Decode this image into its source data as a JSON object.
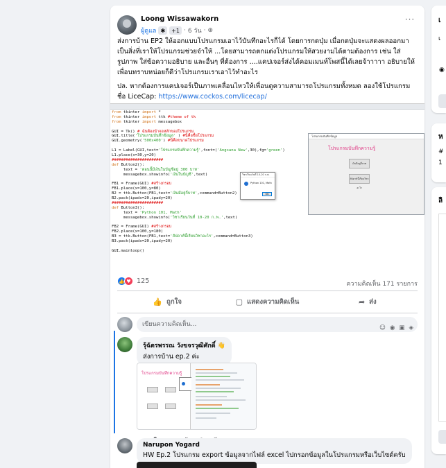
{
  "post": {
    "author": "Loong Wissawakorn",
    "role": "ผู้ดูแล",
    "badge": "+1",
    "time": "6 วัน",
    "privacy_icon": "globe-icon",
    "more_icon": "more-horizontal-icon",
    "paragraph1": "ส่งการบ้าน EP2 ให้ออกแบบโปรแกรมเอาไว้บันทึกอะไรก็ได้ โดยการกดปุ่ม เมื่อกดปุ่มจะแสดงผลออกมาเป็นสิ่งที่เราให้โปรแกรมช่วยจำให้ ...โดยสามารถตกแต่งโปรแกรมให้สวยงามได้ตามต้องการ เช่น ใส่รูปภาพ ใส่ข้อความอธิบาย และอื่นๆ ที่ต้องการ ....แคปเจอร์ส่งได้คอมเมนท์โพสนี้ได้เลยจ้าาาาา อธิบายให้เพื่อนทราบหน่อยก็ดีว่าโปรแกรมเราเอาไว้ทำอะไร",
    "paragraph2": "ปล. หากต้องการแคปเจอร์เป็นภาพเคลื่อนไหวให้เพื่อนดูความสามารถโปรแกรมทั้งหมด ลองใช้โปรแกรมชื่อ LiceCap: ",
    "link": "https://www.cockos.com/licecap/"
  },
  "screenshot": {
    "code_lines": [
      [
        [
          "kw",
          "from "
        ],
        [
          "",
          "tkinter "
        ],
        [
          "kw",
          "import "
        ],
        [
          "",
          "*"
        ]
      ],
      [
        [
          "kw",
          "from "
        ],
        [
          "",
          "tkinter "
        ],
        [
          "kw",
          "import "
        ],
        [
          "",
          "ttk "
        ],
        [
          "cm",
          "#theme of tk"
        ]
      ],
      [
        [
          "kw",
          "from "
        ],
        [
          "",
          "tkinter "
        ],
        [
          "kw",
          "import "
        ],
        [
          "",
          "messagebox"
        ]
      ],
      [
        [
          "",
          ""
        ]
      ],
      [
        [
          "",
          "GUI = Tk() "
        ],
        [
          "cm",
          "# ฉันต้องนำจอหลักของโปรแกรม"
        ]
      ],
      [
        [
          "",
          "GUI.title("
        ],
        [
          "st",
          "'โปรแกรมบันทึกข้อมูล'"
        ],
        [
          "",
          " ) "
        ],
        [
          "cm",
          "#นี่คือชื่อโปรแกรม"
        ]
      ],
      [
        [
          "",
          "GUI.geometry("
        ],
        [
          "st",
          "'500x400'"
        ],
        [
          "",
          ") "
        ],
        [
          "cm",
          "#นี่คือขนาดโปรแกรม"
        ]
      ],
      [
        [
          "",
          ""
        ]
      ],
      [
        [
          "",
          "L1 = Label(GUI,text="
        ],
        [
          "st",
          "'โปรแกรมบันทึกความรู้'"
        ],
        [
          "",
          ",font=("
        ],
        [
          "st",
          "'Angsana New'"
        ],
        [
          "",
          ",30),fg="
        ],
        [
          "st",
          "'green'"
        ],
        [
          "",
          ")"
        ]
      ],
      [
        [
          "",
          "L1.place(x=30,y=20)"
        ]
      ],
      [
        [
          "cm",
          "######################"
        ]
      ],
      [
        [
          "kw",
          "def "
        ],
        [
          "",
          "Button2():"
        ]
      ],
      [
        [
          "",
          "     text = "
        ],
        [
          "st",
          "'ตอนนี้มีเงินในบัญชีอยู่ 300 บาท'"
        ]
      ],
      [
        [
          "",
          "     messagebox.showinfo("
        ],
        [
          "st",
          "'เงินในบัญชี'"
        ],
        [
          "",
          ",text)"
        ]
      ],
      [
        [
          "",
          ""
        ]
      ],
      [
        [
          "",
          "FB1 = Frame(GUI) "
        ],
        [
          "cm",
          "#สร้างกรอบ"
        ]
      ],
      [
        [
          "",
          "FB1.place(x=100,y=80)"
        ]
      ],
      [
        [
          "",
          "B2 = ttk.Button(FB1,text="
        ],
        [
          "st",
          "'เงินมีอยู่กี่บาท'"
        ],
        [
          "",
          ",command=Button2)"
        ]
      ],
      [
        [
          "",
          "B2.pack(ipadx=20,ipady=20)"
        ]
      ],
      [
        [
          "cm",
          "######################"
        ]
      ],
      [
        [
          "kw",
          "def "
        ],
        [
          "",
          "Button3():"
        ]
      ],
      [
        [
          "",
          "     text = "
        ],
        [
          "st",
          "'Python 101, Math'"
        ]
      ],
      [
        [
          "",
          "     messagebox.showinfo("
        ],
        [
          "st",
          "'วิชาเรียนวันที่ 10-20 ก.พ.'"
        ],
        [
          "",
          ",text)"
        ]
      ],
      [
        [
          "",
          ""
        ]
      ],
      [
        [
          "",
          "FB2 = Frame(GUI) "
        ],
        [
          "cm",
          "#สร้างกรอบ"
        ]
      ],
      [
        [
          "",
          "FB2.place(x=100,y=180)"
        ]
      ],
      [
        [
          "",
          "B3 = ttk.Button(FB1,text="
        ],
        [
          "st",
          "'สัปดาห์นี้เรียนวิชาอะไร'"
        ],
        [
          "",
          ",command=Button3)"
        ]
      ],
      [
        [
          "",
          "B3.pack(ipadx=20,ipady=20)"
        ]
      ],
      [
        [
          "",
          ""
        ]
      ],
      [
        [
          "",
          "GUI.mainloop()"
        ]
      ]
    ],
    "window_title": "โปรแกรมบันทึกข้อมูล",
    "window_heading": "โปรแกรมบันทึกความรู้",
    "button1": "เงินมีอยู่กี่บาท",
    "button2": "สัปดาห์นี้เรียนวิชาอะไร",
    "dialog_title": "วิชาเรียนวันที่ 10-20 ก.พ.",
    "dialog_text": "Python 101, Math",
    "dialog_ok": "OK"
  },
  "stats": {
    "reaction_count": "125",
    "comment_count": "ความคิดเห็น 171 รายการ"
  },
  "actions": {
    "like": "ถูกใจ",
    "comment": "แสดงความคิดเห็น",
    "share": "ส่ง"
  },
  "compose": {
    "placeholder": "เขียนความคิดเห็น..."
  },
  "comments": [
    {
      "name": "รุ้ฉัตรพรรณ วังขจรวุฒิศักดิ์",
      "emoji": "👋",
      "text": "ส่งการบ้าน ep.2 ค่ะ",
      "like": "ถูกใจ",
      "reply": "ตอบกลับ",
      "time": "1 นาที",
      "image_heading": "โปรแกรมบันทึกความรู้"
    },
    {
      "name": "Narupon Yogard",
      "text": "HW Ep.2 โปรแกรม export ข้อมูลจากไฟล์ excel ไปกรอกข้อมูลในโปรแกรมหรือเว็บไซต์ครับ"
    }
  ],
  "colors": {
    "accent": "#1877f2",
    "love": "#f33e58",
    "link": "#216fdb",
    "reply_line": "#1b74e4"
  }
}
